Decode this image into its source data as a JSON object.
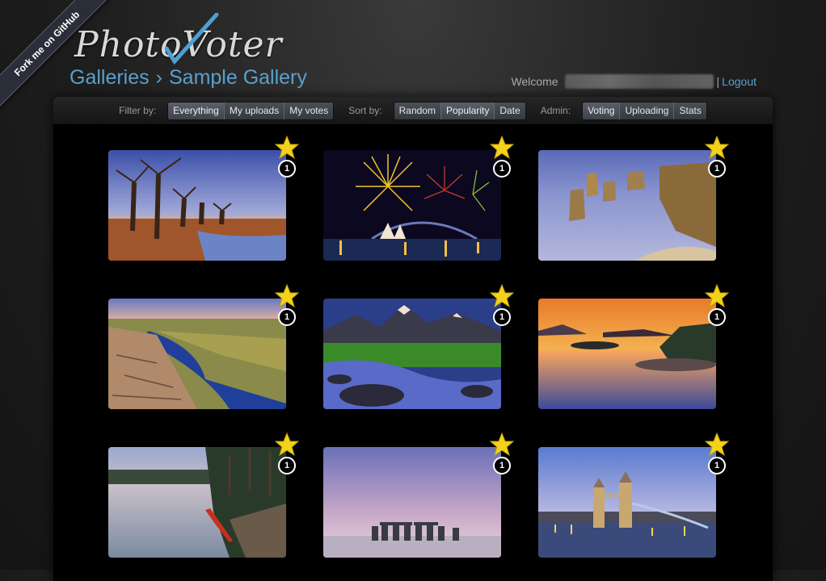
{
  "ribbon": {
    "label": "Fork me on GitHub"
  },
  "logo": {
    "text": "PhotoVoter"
  },
  "breadcrumb": {
    "root": "Galleries",
    "separator": "›",
    "current": "Sample Gallery"
  },
  "user": {
    "welcome": "Welcome",
    "pipe": "|",
    "logout": "Logout"
  },
  "toolbar": {
    "filter_label": "Filter by:",
    "filters": [
      "Everything",
      "My uploads",
      "My votes"
    ],
    "filter_active": "Everything",
    "sort_label": "Sort by:",
    "sorts": [
      "Random",
      "Popularity",
      "Date"
    ],
    "sort_active": "Popularity",
    "admin_label": "Admin:",
    "admin": [
      "Voting",
      "Uploading",
      "Stats"
    ],
    "admin_active": "Voting"
  },
  "photos": [
    {
      "scene": "baobab-trees",
      "votes": "1",
      "star_icon": "star-icon"
    },
    {
      "scene": "sydney-fireworks",
      "votes": "1",
      "star_icon": "star-icon"
    },
    {
      "scene": "twelve-apostles",
      "votes": "1",
      "star_icon": "star-icon"
    },
    {
      "scene": "river-gorge",
      "votes": "1",
      "star_icon": "star-icon"
    },
    {
      "scene": "mountain-stream",
      "votes": "1",
      "star_icon": "star-icon"
    },
    {
      "scene": "sunset-lake",
      "votes": "1",
      "star_icon": "star-icon"
    },
    {
      "scene": "misty-lake-canoe",
      "votes": "1",
      "star_icon": "star-icon"
    },
    {
      "scene": "stonehenge",
      "votes": "1",
      "star_icon": "star-icon"
    },
    {
      "scene": "tower-bridge",
      "votes": "1",
      "star_icon": "star-icon"
    }
  ],
  "colors": {
    "accent": "#5aa0cc",
    "star": "#f2d21b"
  }
}
